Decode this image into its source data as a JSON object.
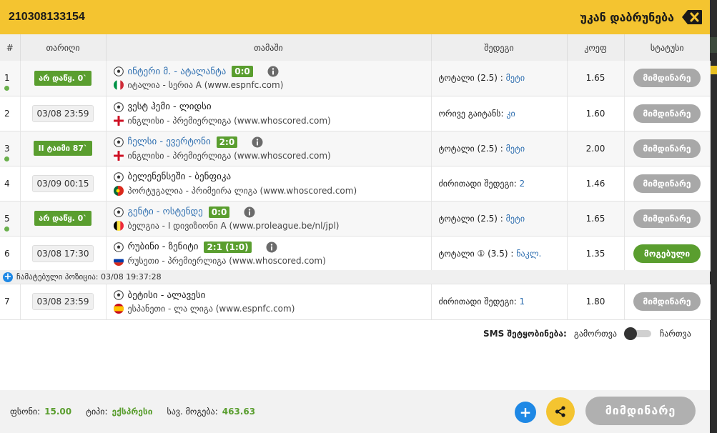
{
  "header": {
    "ticket_id": "210308133154",
    "back_label": "უკან დაბრუნება"
  },
  "columns": {
    "num": "#",
    "date": "თარიღი",
    "game": "თამაში",
    "result": "შედეგი",
    "odds": "კოეფ",
    "status": "სტატუსი"
  },
  "rows": [
    {
      "num": "1",
      "date": "არ დაწყ. 0`",
      "date_live": true,
      "dot": true,
      "team": "ინტერი მ. - ატალანტა",
      "team_live": true,
      "score": "0:0",
      "info": true,
      "flag": "italy-flag-icon",
      "league": "იტალია - სერია A (www.espnfc.com)",
      "result_label": "ტოტალი (2.5) : ",
      "result_pick": "მეტი",
      "odds": "1.65",
      "status": "მიმდინარე",
      "status_won": false
    },
    {
      "num": "2",
      "date": "03/08 23:59",
      "date_live": false,
      "dot": false,
      "team": "ვესტ ჰემი - ლიდსი",
      "team_live": false,
      "score": "",
      "info": false,
      "flag": "england-flag-icon",
      "league": "ინგლისი - პრემიერლიგა (www.whoscored.com)",
      "result_label": "ორივე გაიტანს: ",
      "result_pick": "კი",
      "odds": "1.60",
      "status": "მიმდინარე",
      "status_won": false
    },
    {
      "num": "3",
      "date": "II ტაიმი 87`",
      "date_live": true,
      "dot": true,
      "team": "ჩელსი - ევერტონი",
      "team_live": true,
      "score": "2:0",
      "info": true,
      "flag": "england-flag-icon",
      "league": "ინგლისი - პრემიერლიგა (www.whoscored.com)",
      "result_label": "ტოტალი (2.5) : ",
      "result_pick": "მეტი",
      "odds": "2.00",
      "status": "მიმდინარე",
      "status_won": false
    },
    {
      "num": "4",
      "date": "03/09 00:15",
      "date_live": false,
      "dot": false,
      "team": "ბელენენსეში - ბენფიკა",
      "team_live": false,
      "score": "",
      "info": false,
      "flag": "portugal-flag-icon",
      "league": "პორტუგალია - პრიმეირა ლიგა (www.whoscored.com)",
      "result_label": "ძირითადი შედეგი: ",
      "result_pick": "2",
      "odds": "1.46",
      "status": "მიმდინარე",
      "status_won": false
    },
    {
      "num": "5",
      "date": "არ დაწყ. 0`",
      "date_live": true,
      "dot": true,
      "team": "გენტი - ოსტენდე",
      "team_live": true,
      "score": "0:0",
      "info": true,
      "flag": "belgium-flag-icon",
      "league": "ბელგია - I დივიზიონი A (www.proleague.be/nl/jpl)",
      "result_label": "ტოტალი (2.5) : ",
      "result_pick": "მეტი",
      "odds": "1.65",
      "status": "მიმდინარე",
      "status_won": false
    },
    {
      "num": "6",
      "date": "03/08 17:30",
      "date_live": false,
      "dot": false,
      "team": "რუბინი - ზენიტი",
      "team_live": false,
      "score": "2:1 (1:0)",
      "info": true,
      "flag": "russia-flag-icon",
      "league": "რუსეთი - პრემიერლიგა (www.whoscored.com)",
      "result_label": "ტოტალი ① (3.5) : ",
      "result_pick": "ნაკლ.",
      "odds": "1.35",
      "status": "მოგებული",
      "status_won": true
    }
  ],
  "cashout_text": "ჩამატებული პოზიცია: 03/08 19:37:28",
  "row7": {
    "num": "7",
    "date": "03/08 23:59",
    "team": "ბეტისი - ალავესი",
    "flag": "spain-flag-icon",
    "league": "ესპანეთი - ლა ლიგა (www.espnfc.com)",
    "result_label": "ძირითადი შედეგი: ",
    "result_pick": "1",
    "odds": "1.80",
    "status": "მიმდინარე"
  },
  "sms": {
    "label": "SMS შეტყობინება:",
    "off": "გამორთვა",
    "on": "ჩართვა"
  },
  "footer": {
    "stake_label": "ფსონი:",
    "stake_value": "15.00",
    "type_label": "ტიპი:",
    "type_value": "ექსპრესი",
    "win_label": "სავ. მოგება:",
    "win_value": "463.63",
    "big_status": "მიმდინარე"
  },
  "colors": {
    "accent": "#f4c430",
    "live_green": "#5a9e2f",
    "link_blue": "#2f6fb0",
    "status_grey": "#a8a8a8"
  }
}
